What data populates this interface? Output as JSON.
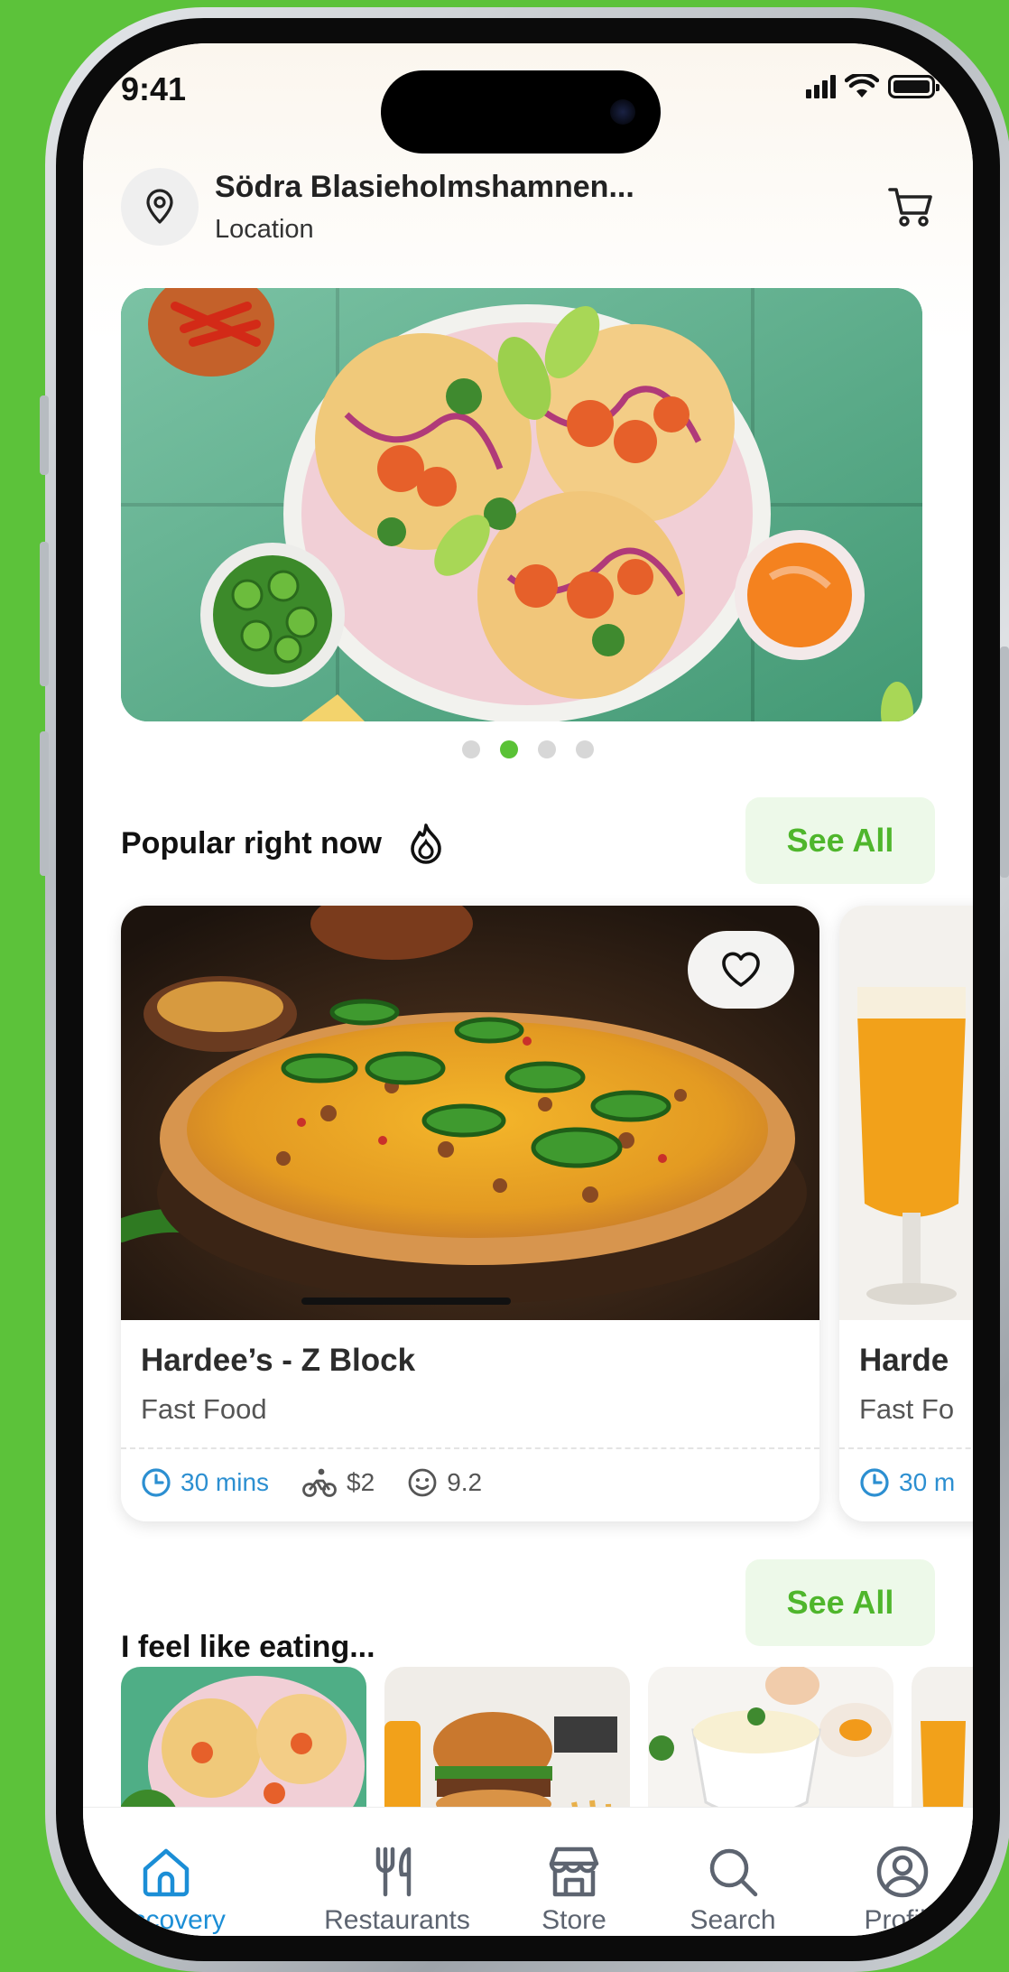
{
  "status_bar": {
    "time": "9:41"
  },
  "header": {
    "location_title": "Södra Blasieholmshamnen...",
    "location_subtitle": "Location"
  },
  "banner": {
    "active_dot": 2,
    "dot_count": 4
  },
  "popular": {
    "title": "Popular right now",
    "see_all": "See All",
    "cards": [
      {
        "name": "Hardee’s - Z Block",
        "category": "Fast Food",
        "time": "30 mins",
        "delivery_fee": "$2",
        "rating": "9.2"
      },
      {
        "name": "Harde",
        "category": "Fast Fo",
        "time": "30 m"
      }
    ]
  },
  "categories": {
    "title": "I feel like eating...",
    "see_all": "See All"
  },
  "bottom_nav": {
    "items": [
      {
        "label": "Discovery",
        "icon": "home-icon",
        "active": true
      },
      {
        "label": "Restaurants",
        "icon": "utensils-icon",
        "active": false
      },
      {
        "label": "Store",
        "icon": "store-icon",
        "active": false
      },
      {
        "label": "Search",
        "icon": "search-icon",
        "active": false
      },
      {
        "label": "Profile",
        "icon": "profile-icon",
        "active": false
      }
    ]
  },
  "colors": {
    "background": "#5cc23a",
    "accent_green": "#5ac236",
    "accent_blue": "#1b8ed6",
    "see_all_bg": "#edf9e9"
  }
}
